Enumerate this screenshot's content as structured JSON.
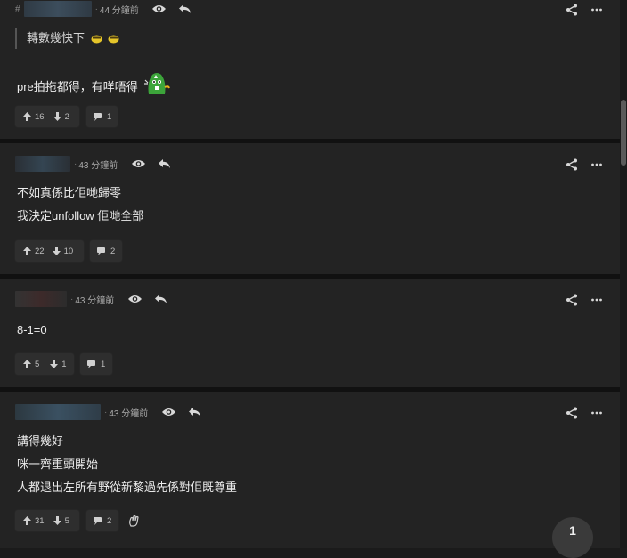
{
  "colors": {
    "background": "#1b1b1b",
    "card": "#232323",
    "text": "#ececec",
    "muted": "#aaaaaa"
  },
  "posts": [
    {
      "time": "44 分鐘前",
      "quote": "轉數幾快下",
      "lines": [
        "pre拍拖都得，有咩唔得"
      ],
      "up": "16",
      "down": "2",
      "comments": "1"
    },
    {
      "time": "43 分鐘前",
      "lines": [
        "不如真係比佢哋歸零",
        "我決定unfollow 佢哋全部"
      ],
      "up": "22",
      "down": "10",
      "comments": "2"
    },
    {
      "time": "43 分鐘前",
      "lines": [
        "8-1=0"
      ],
      "up": "5",
      "down": "1",
      "comments": "1"
    },
    {
      "time": "43 分鐘前",
      "lines": [
        "講得幾好",
        "咪一齊重頭開始",
        "人都退出左所有野從新黎過先係對佢既尊重"
      ],
      "up": "31",
      "down": "5",
      "comments": "2"
    }
  ],
  "pagination": {
    "current": "1"
  }
}
